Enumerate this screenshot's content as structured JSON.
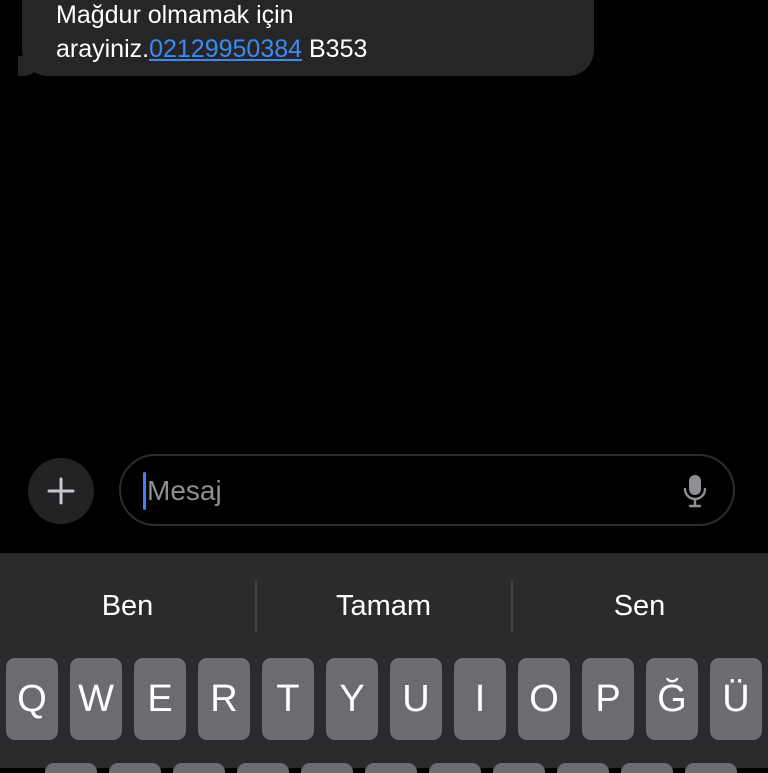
{
  "message": {
    "line1": "Mağdur olmamak için",
    "line2_prefix": "arayiniz.",
    "phone_link": "02129950384",
    "line2_suffix": " B353"
  },
  "compose": {
    "placeholder": "Mesaj"
  },
  "suggestions": [
    "Ben",
    "Tamam",
    "Sen"
  ],
  "keyboard_row1": [
    "Q",
    "W",
    "E",
    "R",
    "T",
    "Y",
    "U",
    "I",
    "O",
    "P",
    "Ğ",
    "Ü"
  ],
  "colors": {
    "background": "#000000",
    "bubble": "#262628",
    "link": "#3b8bf2",
    "keyboard_bg": "#2b2b2d",
    "key": "#6c6c70",
    "caret": "#3b82f6"
  }
}
